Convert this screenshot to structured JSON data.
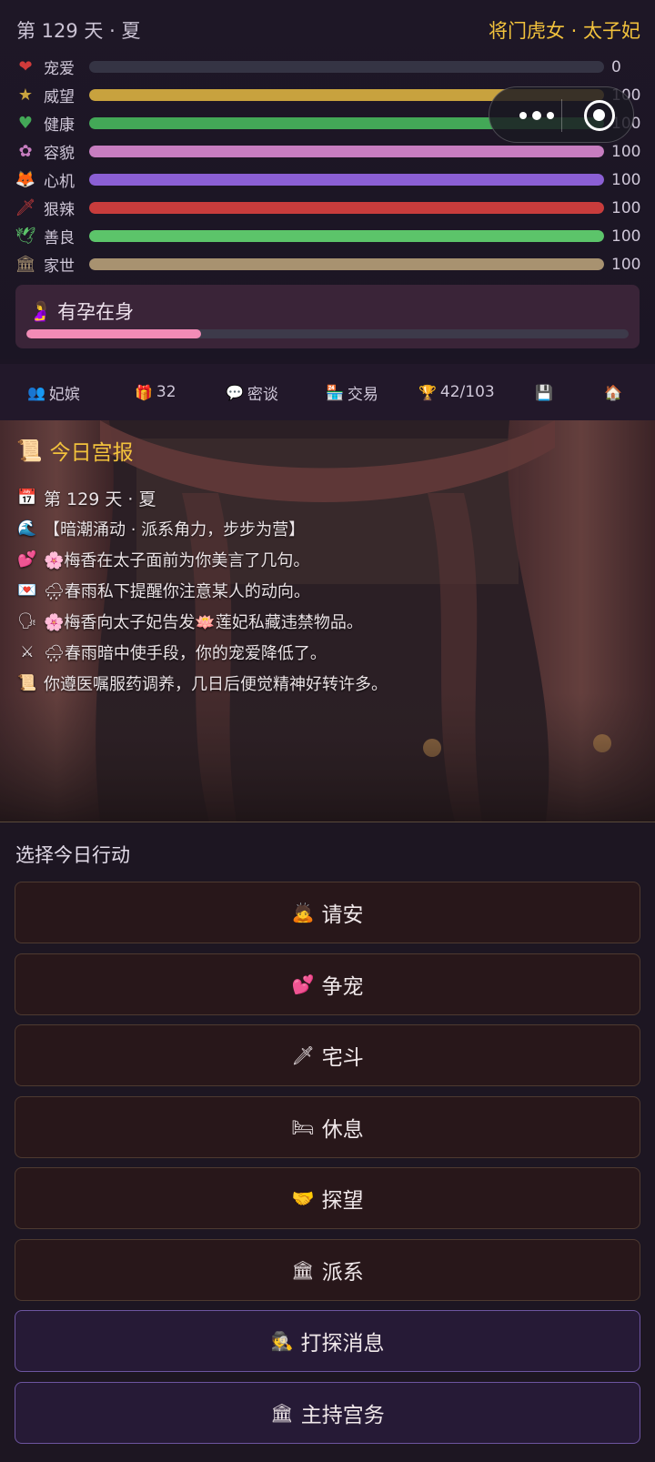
{
  "header": {
    "day": "第 129 天 · 夏",
    "role": "将门虎女 · 太子妃"
  },
  "stats": [
    {
      "icon": "heart-icon",
      "glyph": "❤",
      "name": "宠爱",
      "value": "0",
      "fraction": 0.0,
      "color": "#d23b3b"
    },
    {
      "icon": "star-icon",
      "glyph": "★",
      "name": "威望",
      "value": "100",
      "fraction": 1.0,
      "color": "#c8a23e"
    },
    {
      "icon": "green-heart-icon",
      "glyph": "♥",
      "name": "健康",
      "value": "100",
      "fraction": 1.0,
      "color": "#43a857"
    },
    {
      "icon": "flower-icon",
      "glyph": "✿",
      "name": "容貌",
      "value": "100",
      "fraction": 1.0,
      "color": "#c77dc0"
    },
    {
      "icon": "fox-icon",
      "glyph": "🦊",
      "name": "心机",
      "value": "100",
      "fraction": 1.0,
      "color": "#8b5fd4"
    },
    {
      "icon": "dagger-icon",
      "glyph": "🗡",
      "name": "狠辣",
      "value": "100",
      "fraction": 1.0,
      "color": "#c83c3c"
    },
    {
      "icon": "dove-icon",
      "glyph": "🕊",
      "name": "善良",
      "value": "100",
      "fraction": 1.0,
      "color": "#5cc46a"
    },
    {
      "icon": "building-icon",
      "glyph": "🏛",
      "name": "家世",
      "value": "100",
      "fraction": 1.0,
      "color": "#a89270"
    }
  ],
  "pregnancy": {
    "label": "有孕在身",
    "icon": "pregnant-icon",
    "progress": 0.29,
    "color": "#f28bb6"
  },
  "menu": [
    {
      "icon": "people-icon",
      "glyph": "👥",
      "label": "妃嫔"
    },
    {
      "icon": "gift-icon",
      "glyph": "🎁",
      "label": "32"
    },
    {
      "icon": "chat-icon",
      "glyph": "💬",
      "label": "密谈"
    },
    {
      "icon": "store-icon",
      "glyph": "🏪",
      "label": "交易"
    },
    {
      "icon": "trophy-icon",
      "glyph": "🏆",
      "label": "42/103"
    },
    {
      "icon": "save-icon",
      "glyph": "💾",
      "label": ""
    },
    {
      "icon": "house-icon",
      "glyph": "🏠",
      "label": ""
    }
  ],
  "report": {
    "title": "今日宫报",
    "title_icon": "scroll-icon",
    "date": "第 129 天 · 夏",
    "lines": [
      {
        "icon": "wave-icon",
        "glyph": "🌊",
        "text": "【暗潮涌动 · 派系角力，步步为营】"
      },
      {
        "icon": "hearts-icon",
        "glyph": "💕",
        "text": "🌸梅香在太子面前为你美言了几句。"
      },
      {
        "icon": "letter-icon",
        "glyph": "💌",
        "text": "🌧春雨私下提醒你注意某人的动向。"
      },
      {
        "icon": "speaking-icon",
        "glyph": "🗣",
        "text": "🌸梅香向太子妃告发🪷莲妃私藏违禁物品。"
      },
      {
        "icon": "swords-icon",
        "glyph": "⚔",
        "text": "🌧春雨暗中使手段，你的宠爱降低了。"
      },
      {
        "icon": "scroll-icon",
        "glyph": "📜",
        "text": "你遵医嘱服药调养，几日后便觉精神好转许多。"
      }
    ]
  },
  "actions": {
    "title": "选择今日行动",
    "buttons": [
      {
        "name": "greet-button",
        "icon": "bowing-icon",
        "glyph": "🙇",
        "label": "请安",
        "style": "brown"
      },
      {
        "name": "compete-favor-button",
        "icon": "hearts-icon",
        "glyph": "💕",
        "label": "争宠",
        "style": "brown"
      },
      {
        "name": "house-fight-button",
        "icon": "dagger-icon",
        "glyph": "🗡",
        "label": "宅斗",
        "style": "brown"
      },
      {
        "name": "rest-button",
        "icon": "bed-icon",
        "glyph": "🛏",
        "label": "休息",
        "style": "brown"
      },
      {
        "name": "visit-button",
        "icon": "handshake-icon",
        "glyph": "🤝",
        "label": "探望",
        "style": "brown"
      },
      {
        "name": "faction-button",
        "icon": "building-icon",
        "glyph": "🏛",
        "label": "派系",
        "style": "brown"
      },
      {
        "name": "spy-button",
        "icon": "detective-icon",
        "glyph": "🕵",
        "label": "打探消息",
        "style": "purple"
      },
      {
        "name": "palace-affairs-button",
        "icon": "building-icon",
        "glyph": "🏛",
        "label": "主持宫务",
        "style": "purple"
      }
    ]
  }
}
